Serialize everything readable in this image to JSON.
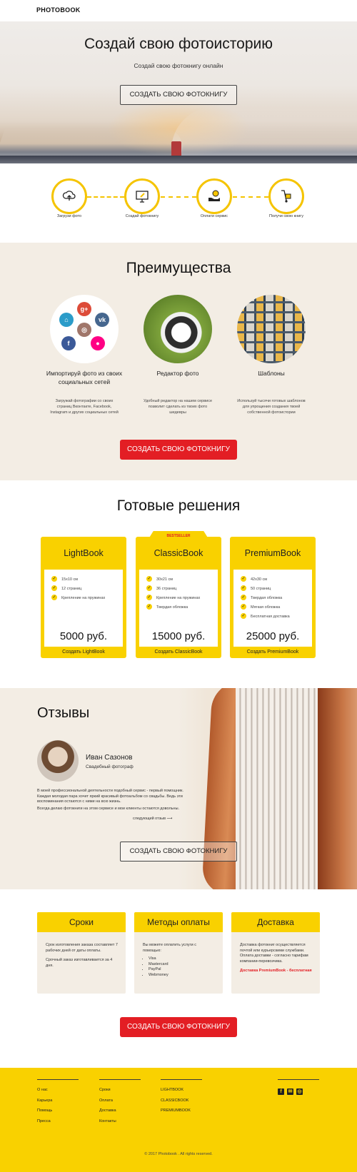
{
  "header": {
    "logo": "PHOTOBOOK"
  },
  "hero": {
    "title": "Создай свою фотоисторию",
    "subtitle": "Создай свою фотокнигу онлайн",
    "cta": "СОЗДАТЬ СВОЮ ФОТОКНИГУ"
  },
  "steps": {
    "accent": "#f5c400",
    "items": [
      {
        "label": "Загрузи фото",
        "icon": "cloud-upload-icon"
      },
      {
        "label": "Создай фотокнигу",
        "icon": "monitor-edit-icon"
      },
      {
        "label": "Оплати сервис",
        "icon": "hand-coin-icon"
      },
      {
        "label": "Получи свою книгу",
        "icon": "hand-truck-icon"
      }
    ]
  },
  "advantages": {
    "title": "Преимущества",
    "items": [
      {
        "title": "Импортируй фото из своих социальных сетей",
        "text": "Загружай фотографии со своих страниц Вконтакте, Facebook, Instagram и других социальных сетей"
      },
      {
        "title": "Редактор фото",
        "text": "Удобный редактор на нашем сервисе позволит сделать из твоих фото шедевры"
      },
      {
        "title": "Шаблоны",
        "text": "Используй тысячи готовых шаблонов для упрощения создания твоей собственной фотоистории"
      }
    ],
    "social": {
      "gplus": "g+",
      "vk": "vk",
      "fb": "f",
      "home": "⌂",
      "insta": "◎",
      "flickr": "●"
    },
    "cta": "СОЗДАТЬ СВОЮ ФОТОКНИГУ"
  },
  "pricing": {
    "title": "Готовые решения",
    "badge": "BESTSELLER",
    "plans": [
      {
        "name": "LightBook",
        "features": [
          "15x10 см",
          "12 страниц",
          "Крепление на пружинах"
        ],
        "price": "5000 руб.",
        "buy": "Создать LightBook"
      },
      {
        "name": "ClassicBook",
        "features": [
          "30x21 см",
          "36 страниц",
          "Крепление на пружинах",
          "Твердая обложка"
        ],
        "price": "15000 руб.",
        "buy": "Создать ClassicBook"
      },
      {
        "name": "PremiumBook",
        "features": [
          "42x30 см",
          "50 страниц",
          "Твердая обложка",
          "Мягкая обложка",
          "Бесплатная доставка"
        ],
        "price": "25000 руб.",
        "buy": "Создать PremiumBook"
      }
    ]
  },
  "reviews": {
    "title": "Отзывы",
    "name": "Иван Сазонов",
    "role": "Свадебный фотограф",
    "text1": "В моей профессиональной деятельности подобный сервис - первый помощник. Каждая молодая пара хочет яркий красивый фотоальбом со свадьбы. Ведь эти воспоминания остаются с ними на всю жизнь.",
    "text2": "Всегда делаю фотокниги на этом сервисе и мои клиенты остаются довольны.",
    "next": "следующий отзыв ⟶",
    "cta": "СОЗДАТЬ СВОЮ ФОТОКНИГУ"
  },
  "info": {
    "cards": [
      {
        "title": "Сроки",
        "p1": "Срок изготовления заказа составляет 7 рабочих дней от даты оплаты.",
        "p2": "Срочный заказ изготавливается за 4 дня."
      },
      {
        "title": "Методы оплаты",
        "p1": "Вы можете оплатить услуги с помощью:",
        "list": [
          "Visa",
          "Mastercard",
          "PayPal",
          "Webmoney"
        ]
      },
      {
        "title": "Доставка",
        "p1": "Доставка фотокниг осуществляется почтой или курьерскими службами. Оплата доставки - согласно тарифам компании-перевозчика.",
        "red": "Доставка PremiumBook - бесплатная"
      }
    ],
    "cta": "СОЗДАТЬ СВОЮ ФОТОКНИГУ"
  },
  "footer": {
    "col1": [
      "О нас",
      "Карьера",
      "Помощь",
      "Пресса"
    ],
    "col2": [
      "Сроки",
      "Оплата",
      "Доставка",
      "Контакты"
    ],
    "col3": [
      "LIGHTBOOK",
      "CLASSICBOOK",
      "PREMIUMBOOK"
    ],
    "social": {
      "fb": "f",
      "mail": "✉",
      "insta": "◎"
    },
    "copyright": "© 2017 Photobook . All rights reserved."
  },
  "colors": {
    "yellow": "#f9d100",
    "red": "#e31e24",
    "beige": "#f3ede4"
  }
}
